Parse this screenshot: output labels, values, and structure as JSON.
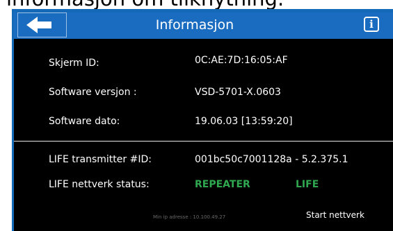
{
  "caption": "informasjon om tilknytning.",
  "header": {
    "title": "Informasjon",
    "back_icon": "arrow-left-icon",
    "info_icon": "info-icon",
    "info_glyph": "i"
  },
  "info": {
    "rows": [
      {
        "label": "Skjerm ID:",
        "value": "0C:AE:7D:16:05:AF"
      },
      {
        "label": "Software versjon :",
        "value": "VSD-5701-X.0603"
      },
      {
        "label": "Software dato:",
        "value": "19.06.03 [13:59:20]"
      }
    ]
  },
  "life": {
    "transmitter_label": "LIFE transmitter #ID:",
    "transmitter_value": "001bc50c7001128a - 5.2.375.1",
    "status_label": "LIFE nettverk status:",
    "status_values": [
      "REPEATER",
      "LIFE"
    ]
  },
  "footer": {
    "ip_text": "Min ip adresse : 10.100.49.27",
    "start_label": "Start nettverk"
  },
  "colors": {
    "frame_blue": "#1469b8",
    "titlebar_blue": "#1a6cc0",
    "screen_bg": "#000000",
    "status_green": "#2fa84f"
  }
}
